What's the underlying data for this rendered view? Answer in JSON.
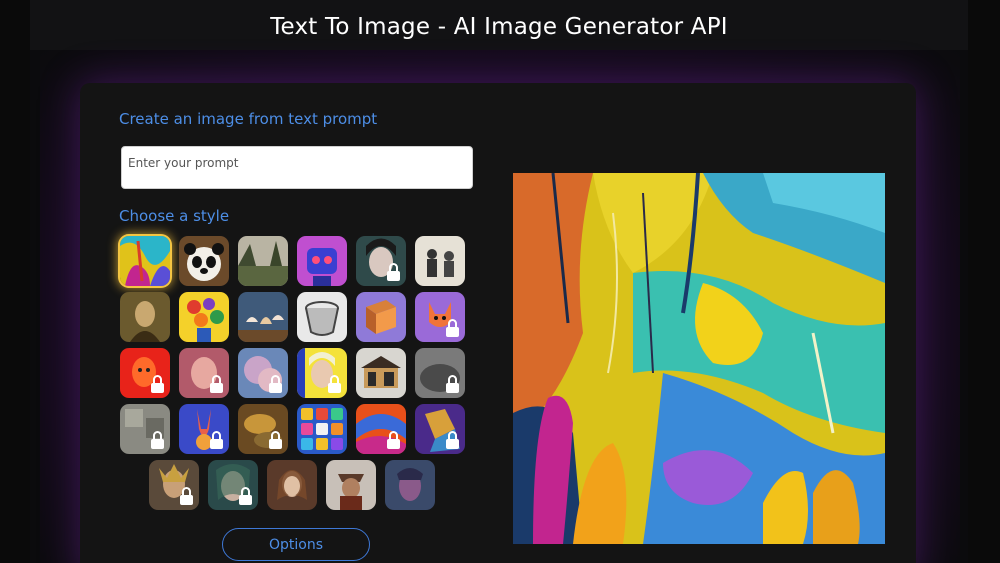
{
  "header": {
    "title": "Text To Image - AI Image Generator API"
  },
  "form": {
    "create_label": "Create an image from text prompt",
    "prompt_placeholder": "Enter your prompt",
    "prompt_value": "",
    "style_label": "Choose a style",
    "options_label": "Options"
  },
  "styles": [
    {
      "name": "abstract-painting",
      "locked": false,
      "selected": true
    },
    {
      "name": "panda-cartoon",
      "locked": false
    },
    {
      "name": "landscape",
      "locked": false
    },
    {
      "name": "robot-3d",
      "locked": false
    },
    {
      "name": "anime-portrait",
      "locked": true
    },
    {
      "name": "vintage-photo",
      "locked": false
    },
    {
      "name": "renaissance",
      "locked": false
    },
    {
      "name": "flowers-still-life",
      "locked": false
    },
    {
      "name": "ballet-painting",
      "locked": false
    },
    {
      "name": "pencil-sketch",
      "locked": false
    },
    {
      "name": "isometric",
      "locked": false
    },
    {
      "name": "fox-illustration",
      "locked": true
    },
    {
      "name": "red-neon",
      "locked": true
    },
    {
      "name": "portrait-soft",
      "locked": true
    },
    {
      "name": "pastel",
      "locked": true
    },
    {
      "name": "pop-art",
      "locked": true
    },
    {
      "name": "architecture",
      "locked": false
    },
    {
      "name": "stone-texture",
      "locked": true
    },
    {
      "name": "mosaic",
      "locked": true
    },
    {
      "name": "rabbit-fantasy",
      "locked": true
    },
    {
      "name": "golden-abstract",
      "locked": true
    },
    {
      "name": "icon-set",
      "locked": false
    },
    {
      "name": "colorful-abstract",
      "locked": true
    },
    {
      "name": "cubism",
      "locked": true
    },
    {
      "name": "fantasy-warrior",
      "locked": true
    },
    {
      "name": "ethereal",
      "locked": true
    },
    {
      "name": "classical-portrait",
      "locked": false
    },
    {
      "name": "steampunk",
      "locked": false
    },
    {
      "name": "cyber-portrait",
      "locked": false
    }
  ],
  "colors": {
    "accent": "#4d8ee6",
    "panel": "#141414",
    "glow": "#7a2aa8"
  }
}
